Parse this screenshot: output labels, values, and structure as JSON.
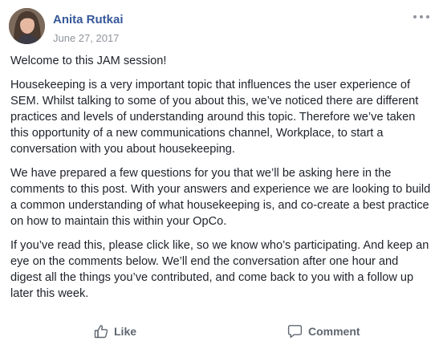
{
  "post": {
    "author": "Anita Rutkai",
    "date": "June 27, 2017",
    "paragraphs": [
      "Welcome to this JAM session!",
      "Housekeeping is a very important topic that influences the user experience of SEM. Whilst talking to some of you about this, we’ve noticed there are different practices and levels of understanding around this topic. Therefore we’ve taken this opportunity of a new communications channel, Workplace, to start a conversation with you about housekeeping.",
      "We have prepared a few questions for you that we’ll be asking here in the comments to this post. With your answers and experience we are looking to build a common understanding of what housekeeping is, and co-create a best practice on how to maintain this within your OpCo.",
      "If you’ve read this, please click like, so we know who’s participating. And keep an eye on the comments below. We’ll end the conversation after one hour and digest all the things you’ve contributed, and come back to you with a follow up later this week."
    ]
  },
  "actions": {
    "like_label": "Like",
    "comment_label": "Comment"
  },
  "colors": {
    "author_link": "#365899",
    "meta_text": "#90949c",
    "body_text": "#1d2129",
    "action_text": "#606770"
  },
  "icons": {
    "more": "more-options-icon",
    "like": "thumbs-up-icon",
    "comment": "speech-bubble-icon"
  }
}
